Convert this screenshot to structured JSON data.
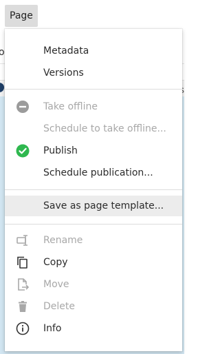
{
  "menu_trigger": {
    "label": "Page"
  },
  "menu": {
    "items": [
      {
        "label": "Metadata",
        "enabled": true
      },
      {
        "label": "Versions",
        "enabled": true
      },
      {
        "label": "Take offline",
        "enabled": false,
        "icon": "minus-circle-icon"
      },
      {
        "label": "Schedule to take offline...",
        "enabled": false
      },
      {
        "label": "Publish",
        "enabled": true,
        "icon": "check-circle-icon",
        "icon_color": "#2fb84f"
      },
      {
        "label": "Schedule publication...",
        "enabled": true
      },
      {
        "label": "Save as page template...",
        "enabled": true,
        "selected": true
      },
      {
        "label": "Rename",
        "enabled": false,
        "icon": "rename-icon"
      },
      {
        "label": "Copy",
        "enabled": true,
        "icon": "copy-icon"
      },
      {
        "label": "Move",
        "enabled": false,
        "icon": "move-icon"
      },
      {
        "label": "Delete",
        "enabled": false,
        "icon": "trash-icon"
      },
      {
        "label": "Info",
        "enabled": true,
        "icon": "info-icon"
      }
    ]
  },
  "colors": {
    "selected_bg": "#ececec",
    "disabled_text": "#a8a8a8",
    "publish_green": "#2fb84f",
    "background_blue": "#d2e6f2"
  }
}
